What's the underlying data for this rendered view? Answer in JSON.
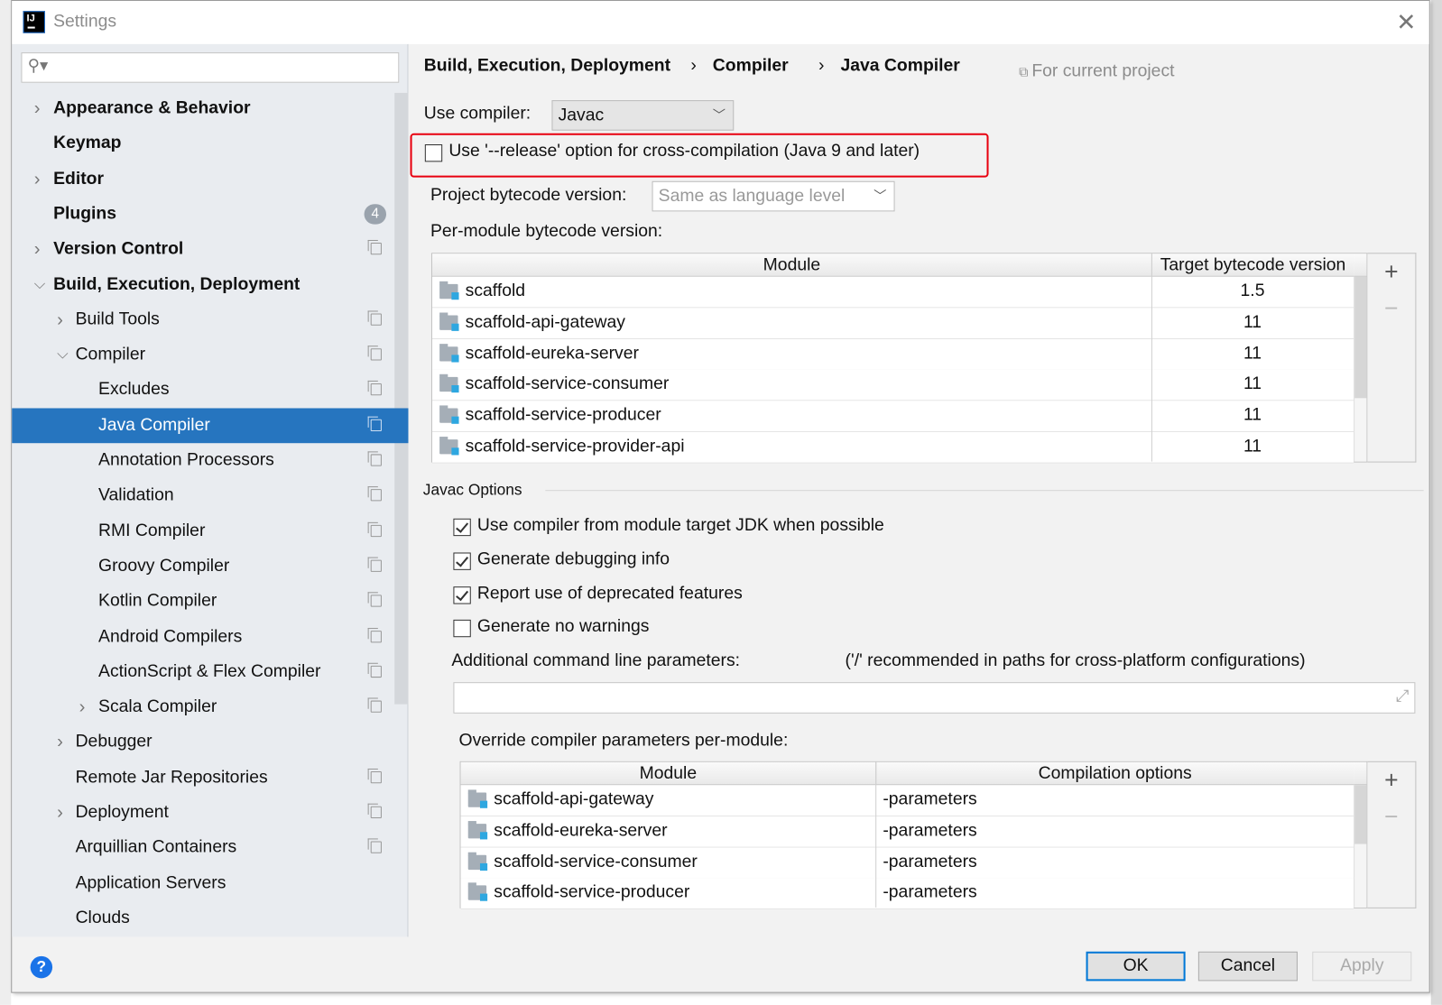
{
  "window": {
    "title": "Settings",
    "logo_text": "IJ",
    "close_icon": "close-icon"
  },
  "sidebar": {
    "search_placeholder": "",
    "items": [
      {
        "label": "Appearance & Behavior",
        "level": 0,
        "expandable": true,
        "expanded": false,
        "bold": true
      },
      {
        "label": "Keymap",
        "level": 0,
        "expandable": false,
        "bold": true
      },
      {
        "label": "Editor",
        "level": 0,
        "expandable": true,
        "expanded": false,
        "bold": true
      },
      {
        "label": "Plugins",
        "level": 0,
        "expandable": false,
        "bold": true,
        "badge": "4"
      },
      {
        "label": "Version Control",
        "level": 0,
        "expandable": true,
        "expanded": false,
        "bold": true,
        "project": true
      },
      {
        "label": "Build, Execution, Deployment",
        "level": 0,
        "expandable": true,
        "expanded": true,
        "bold": true
      },
      {
        "label": "Build Tools",
        "level": 1,
        "expandable": true,
        "expanded": false,
        "project": true
      },
      {
        "label": "Compiler",
        "level": 1,
        "expandable": true,
        "expanded": true,
        "project": true
      },
      {
        "label": "Excludes",
        "level": 2,
        "project": true
      },
      {
        "label": "Java Compiler",
        "level": 2,
        "project": true,
        "selected": true
      },
      {
        "label": "Annotation Processors",
        "level": 2,
        "project": true
      },
      {
        "label": "Validation",
        "level": 2,
        "project": true
      },
      {
        "label": "RMI Compiler",
        "level": 2,
        "project": true
      },
      {
        "label": "Groovy Compiler",
        "level": 2,
        "project": true
      },
      {
        "label": "Kotlin Compiler",
        "level": 2,
        "project": true
      },
      {
        "label": "Android Compilers",
        "level": 2,
        "project": true
      },
      {
        "label": "ActionScript & Flex Compiler",
        "level": 2,
        "project": true
      },
      {
        "label": "Scala Compiler",
        "level": 2,
        "expandable": true,
        "expanded": false,
        "project": true
      },
      {
        "label": "Debugger",
        "level": 1,
        "expandable": true,
        "expanded": false
      },
      {
        "label": "Remote Jar Repositories",
        "level": 1,
        "project": true
      },
      {
        "label": "Deployment",
        "level": 1,
        "expandable": true,
        "expanded": false,
        "project": true
      },
      {
        "label": "Arquillian Containers",
        "level": 1,
        "project": true
      },
      {
        "label": "Application Servers",
        "level": 1
      },
      {
        "label": "Clouds",
        "level": 1
      }
    ]
  },
  "breadcrumb": {
    "parts": [
      "Build, Execution, Deployment",
      "Compiler",
      "Java Compiler"
    ],
    "separator": "›",
    "scope": "For current project"
  },
  "compiler": {
    "label": "Use compiler:",
    "value": "Javac"
  },
  "release_option": {
    "label": "Use '--release' option for cross-compilation (Java 9 and later)",
    "checked": false,
    "highlight_color": "#e8000f"
  },
  "bytecode": {
    "label": "Project bytecode version:",
    "placeholder": "Same as language level"
  },
  "per_module": {
    "label": "Per-module bytecode version:",
    "columns": [
      "Module",
      "Target bytecode version"
    ],
    "rows": [
      [
        "scaffold",
        "1.5"
      ],
      [
        "scaffold-api-gateway",
        "11"
      ],
      [
        "scaffold-eureka-server",
        "11"
      ],
      [
        "scaffold-service-consumer",
        "11"
      ],
      [
        "scaffold-service-producer",
        "11"
      ],
      [
        "scaffold-service-provider-api",
        "11"
      ]
    ]
  },
  "javac": {
    "section": "Javac Options",
    "options": [
      {
        "label": "Use compiler from module target JDK when possible",
        "checked": true
      },
      {
        "label": "Generate debugging info",
        "checked": true
      },
      {
        "label": "Report use of deprecated features",
        "checked": true
      },
      {
        "label": "Generate no warnings",
        "checked": false
      }
    ],
    "additional_label": "Additional command line parameters:",
    "additional_hint": "('/' recommended in paths for cross-platform configurations)",
    "additional_value": ""
  },
  "override": {
    "label": "Override compiler parameters per-module:",
    "columns": [
      "Module",
      "Compilation options"
    ],
    "rows": [
      [
        "scaffold-api-gateway",
        "-parameters"
      ],
      [
        "scaffold-eureka-server",
        "-parameters"
      ],
      [
        "scaffold-service-consumer",
        "-parameters"
      ],
      [
        "scaffold-service-producer",
        "-parameters"
      ]
    ]
  },
  "table_tools": {
    "add": "+",
    "remove": "−"
  },
  "buttons": {
    "ok": "OK",
    "cancel": "Cancel",
    "apply": "Apply",
    "help": "?"
  },
  "colors": {
    "selection": "#2675bf",
    "accent": "#0078d7"
  }
}
